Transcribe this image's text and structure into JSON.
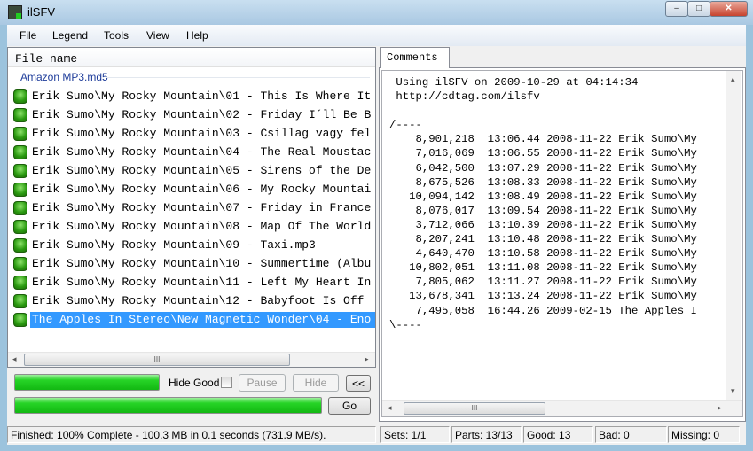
{
  "window": {
    "title": "ilSFV",
    "minimize": "–",
    "maximize": "□",
    "close": "✕"
  },
  "menu": [
    "File",
    "Legend",
    "Tools",
    "View",
    "Help"
  ],
  "file_list": {
    "header": "File name",
    "group": "Amazon MP3.md5",
    "items": [
      "Erik Sumo\\My Rocky Mountain\\01 - This Is Where It",
      "Erik Sumo\\My Rocky Mountain\\02 - Friday I´ll Be B",
      "Erik Sumo\\My Rocky Mountain\\03 - Csillag vagy fel",
      "Erik Sumo\\My Rocky Mountain\\04 - The Real Moustac",
      "Erik Sumo\\My Rocky Mountain\\05 - Sirens of the De",
      "Erik Sumo\\My Rocky Mountain\\06 - My Rocky Mountai",
      "Erik Sumo\\My Rocky Mountain\\07 - Friday in France",
      "Erik Sumo\\My Rocky Mountain\\08 - Map Of The World",
      "Erik Sumo\\My Rocky Mountain\\09 - Taxi.mp3",
      "Erik Sumo\\My Rocky Mountain\\10 - Summertime (Albu",
      "Erik Sumo\\My Rocky Mountain\\11 - Left My Heart In",
      "Erik Sumo\\My Rocky Mountain\\12 - Babyfoot Is Off",
      "The Apples In Stereo\\New Magnetic Wonder\\04 - Eno"
    ],
    "selected_index": 12
  },
  "controls": {
    "hide_good": "Hide Good",
    "pause": "Pause",
    "hide": "Hide",
    "collapse": "<<",
    "go": "Go",
    "progress_file": 100,
    "progress_total": 100
  },
  "comments": {
    "tab": "Comments",
    "text": " Using ilSFV on 2009-10-29 at 04:14:34\n http://cdtag.com/ilsfv\n\n/----\n    8,901,218  13:06.44 2008-11-22 Erik Sumo\\My\n    7,016,069  13:06.55 2008-11-22 Erik Sumo\\My\n    6,042,500  13:07.29 2008-11-22 Erik Sumo\\My\n    8,675,526  13:08.33 2008-11-22 Erik Sumo\\My\n   10,094,142  13:08.49 2008-11-22 Erik Sumo\\My\n    8,076,017  13:09.54 2008-11-22 Erik Sumo\\My\n    3,712,066  13:10.39 2008-11-22 Erik Sumo\\My\n    8,207,241  13:10.48 2008-11-22 Erik Sumo\\My\n    4,640,470  13:10.58 2008-11-22 Erik Sumo\\My\n   10,802,051  13:11.08 2008-11-22 Erik Sumo\\My\n    7,805,062  13:11.27 2008-11-22 Erik Sumo\\My\n   13,678,341  13:13.24 2008-11-22 Erik Sumo\\My\n    7,495,058  16:44.26 2009-02-15 The Apples I\n\\----"
  },
  "status": {
    "message": "Finished: 100% Complete - 100.3 MB in 0.1 seconds (731.9 MB/s).",
    "sets": "Sets: 1/1",
    "parts": "Parts: 13/13",
    "good": "Good: 13",
    "bad": "Bad: 0",
    "missing": "Missing: 0"
  },
  "scroll": {
    "thumb_glyph": "III",
    "left": "◂",
    "right": "▸",
    "up": "▴",
    "down": "▾"
  }
}
